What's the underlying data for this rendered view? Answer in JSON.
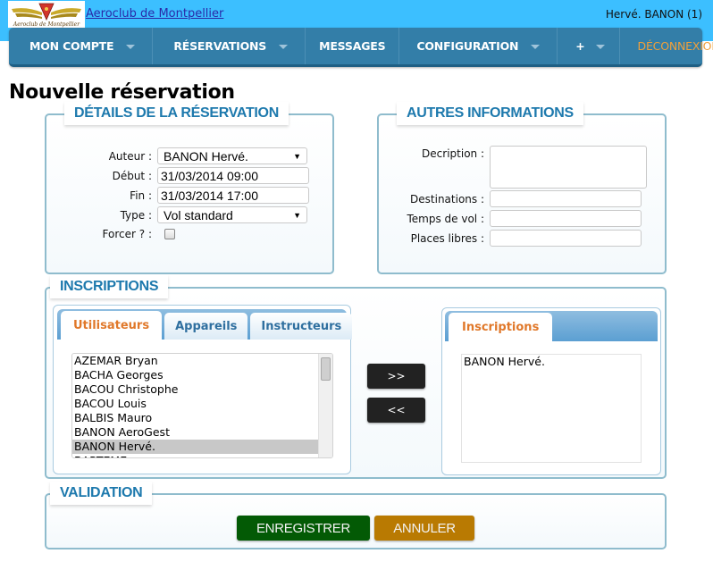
{
  "header": {
    "site_name": "Aeroclub de Montpellier",
    "logo_text": "Aeroclub de Montpellier",
    "user": "Hervé. BANON (1)"
  },
  "nav": {
    "items": [
      {
        "label": "MON COMPTE",
        "has_dropdown": true
      },
      {
        "label": "RÉSERVATIONS",
        "has_dropdown": true
      },
      {
        "label": "MESSAGES",
        "has_dropdown": false
      },
      {
        "label": "CONFIGURATION",
        "has_dropdown": true
      },
      {
        "label": "+",
        "has_dropdown": true
      }
    ],
    "logout": "DÉCONNEXION"
  },
  "page": {
    "title": "Nouvelle réservation"
  },
  "details": {
    "legend": "DÉTAILS DE LA RÉSERVATION",
    "author_label": "Auteur :",
    "author_value": "BANON Hervé.",
    "start_label": "Début :",
    "start_value": "31/03/2014 09:00",
    "end_label": "Fin :",
    "end_value": "31/03/2014 17:00",
    "type_label": "Type :",
    "type_value": "Vol standard",
    "force_label": "Forcer ? :",
    "force_checked": false
  },
  "other": {
    "legend": "AUTRES INFORMATIONS",
    "description_label": "Decription :",
    "description_value": "",
    "destinations_label": "Destinations :",
    "destinations_value": "",
    "flight_time_label": "Temps de vol :",
    "flight_time_value": "",
    "free_seats_label": "Places libres :",
    "free_seats_value": ""
  },
  "inscriptions": {
    "legend": "INSCRIPTIONS",
    "tabs": [
      {
        "label": "Utilisateurs",
        "active": true
      },
      {
        "label": "Appareils",
        "active": false
      },
      {
        "label": "Instructeurs",
        "active": false
      }
    ],
    "users": [
      "AZEMAR Bryan",
      "BACHA Georges",
      "BACOU Christophe",
      "BACOU Louis",
      "BALBIS Mauro",
      "BANON AeroGest",
      "BANON Hervé.",
      "BARTEME"
    ],
    "selected_user": "BANON Hervé.",
    "add_button": ">>",
    "remove_button": "<<",
    "registered_tab": "Inscriptions",
    "registered": [
      "BANON Hervé."
    ]
  },
  "validation": {
    "legend": "VALIDATION",
    "save_label": "ENREGISTRER",
    "cancel_label": "ANNULER",
    "save_color": "#035a05",
    "cancel_color": "#b97a02"
  }
}
